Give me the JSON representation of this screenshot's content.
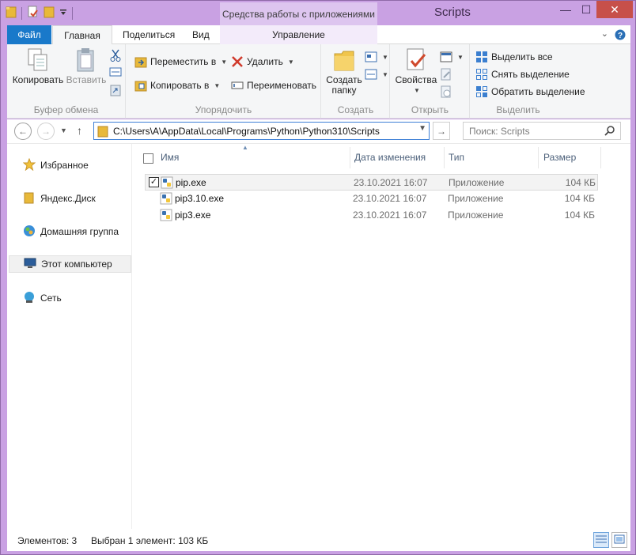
{
  "window": {
    "title": "Scripts",
    "context_tab_group": "Средства работы с приложениями",
    "minimize": "—",
    "maximize": "☐",
    "close": "✕"
  },
  "ribbon_tabs": {
    "file": "Файл",
    "home": "Главная",
    "share": "Поделиться",
    "view": "Вид",
    "manage": "Управление",
    "help": "?",
    "expand": "⌄"
  },
  "ribbon": {
    "clipboard": {
      "label": "Буфер обмена",
      "copy": "Копировать",
      "paste": "Вставить"
    },
    "organize": {
      "label": "Упорядочить",
      "move_to": "Переместить в",
      "copy_to": "Копировать в",
      "delete": "Удалить",
      "rename": "Переименовать"
    },
    "new": {
      "label": "Создать",
      "new_folder_line1": "Создать",
      "new_folder_line2": "папку"
    },
    "open": {
      "label": "Открыть",
      "properties": "Свойства"
    },
    "select": {
      "label": "Выделить",
      "select_all": "Выделить все",
      "select_none": "Снять выделение",
      "invert": "Обратить выделение"
    }
  },
  "address_bar": {
    "path": "C:\\Users\\A\\AppData\\Local\\Programs\\Python\\Python310\\Scripts",
    "search_placeholder": "Поиск: Scripts"
  },
  "nav_pane": {
    "items": [
      {
        "label": "Избранное",
        "icon": "star-icon"
      },
      {
        "label": "Яндекс.Диск",
        "icon": "folder-icon"
      },
      {
        "label": "Домашняя группа",
        "icon": "homegroup-icon"
      },
      {
        "label": "Этот компьютер",
        "icon": "computer-icon"
      },
      {
        "label": "Сеть",
        "icon": "network-icon"
      }
    ]
  },
  "columns": {
    "name": "Имя",
    "date": "Дата изменения",
    "type": "Тип",
    "size": "Размер"
  },
  "files": [
    {
      "name": "pip.exe",
      "date": "23.10.2021 16:07",
      "type": "Приложение",
      "size": "104 КБ",
      "selected": true
    },
    {
      "name": "pip3.10.exe",
      "date": "23.10.2021 16:07",
      "type": "Приложение",
      "size": "104 КБ",
      "selected": false
    },
    {
      "name": "pip3.exe",
      "date": "23.10.2021 16:07",
      "type": "Приложение",
      "size": "104 КБ",
      "selected": false
    }
  ],
  "status": {
    "count": "Элементов: 3",
    "selection": "Выбран 1 элемент: 103 КБ"
  },
  "colors": {
    "frame": "#c9a1e3",
    "file_tab": "#1979ca",
    "close_button": "#c7504a",
    "address_border": "#3d7fd6"
  }
}
